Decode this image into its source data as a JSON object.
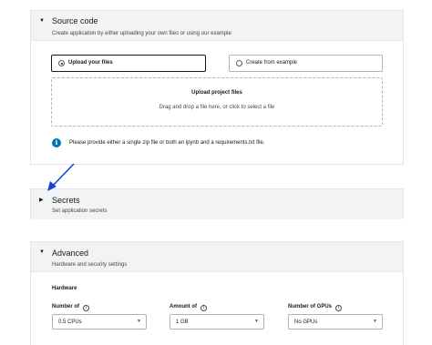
{
  "source_code": {
    "title": "Source code",
    "description": "Create application by either uploading your own files or using our example",
    "options": [
      {
        "label": "Upload your files",
        "selected": true
      },
      {
        "label": "Create from example",
        "selected": false
      }
    ],
    "dropzone": {
      "title": "Upload project files",
      "subtitle": "Drag and drop a file here, or click to select a file"
    },
    "info": "Please provide either a single zip file or both an ipynb and a requirements.txt file."
  },
  "secrets": {
    "title": "Secrets",
    "description": "Set application secrets"
  },
  "advanced": {
    "title": "Advanced",
    "description": "Hardware and security settings",
    "hardware_label": "Hardware",
    "fields": [
      {
        "label": "Number of",
        "value": "0.5 CPUs"
      },
      {
        "label": "Amount of",
        "value": "1 GB"
      },
      {
        "label": "Number of GPUs",
        "value": "No GPUs"
      }
    ]
  },
  "colors": {
    "accent": "#0073bb",
    "annotation_arrow": "#1a3fd6",
    "header_bg": "#f2f3f3"
  }
}
